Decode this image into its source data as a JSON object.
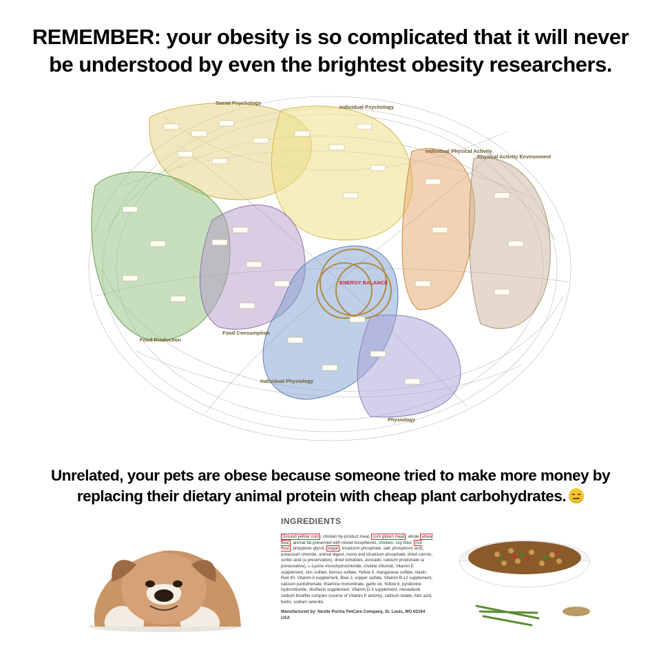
{
  "headline_top": {
    "line1": "REMEMBER:  your obesity is so complicated that it will never",
    "line2": "be understood by even the brightest obesity researchers."
  },
  "diagram": {
    "regions": [
      {
        "label": "Social Psychology",
        "color": "#e8d68a"
      },
      {
        "label": "Individual Psychology",
        "color": "#efe08a"
      },
      {
        "label": "Individual Physical Activity",
        "color": "#e6a66a"
      },
      {
        "label": "Physical Activity Environment",
        "color": "#c9b49a"
      },
      {
        "label": "Food Production",
        "color": "#8fc07a"
      },
      {
        "label": "Food Consumption",
        "color": "#b49ac8"
      },
      {
        "label": "Individual Physiology",
        "color": "#7e9fd0"
      },
      {
        "label": "Physiology",
        "color": "#a8a2d6"
      }
    ],
    "center_label": "ENERGY BALANCE"
  },
  "headline_mid": {
    "line1": "Unrelated, your pets are obese because someone tried to make more money by",
    "line2": "replacing their dietary animal protein with cheap plant carbohydrates."
  },
  "emoji_icon": "expressionless-face-icon",
  "ingredients": {
    "title": "INGREDIENTS",
    "highlighted": [
      "Ground yellow corn",
      "corn gluten meal",
      "wheat flour",
      "rice flour",
      "sugar"
    ],
    "text_1": ", chicken by-product meal, ",
    "text_2": ", whole ",
    "text_3": ", animal fat preserved with mixed-tocopherols, chicken, soy flour, ",
    "text_4": ", propylene glycol, ",
    "text_5": ", tricalcium phosphate, salt, phosphoric acid, potassium chloride, animal digest, mono and dicalcium phosphate, dried carrots, sorbic acid (a preservative), dried tomatoes, avocado, calcium propionate (a preservative), L-Lysine monohydrochloride, choline chloride, Vitamin E supplement, zinc sulfate, ferrous sulfate, Yellow 5, manganese sulfate, niacin, Red 40, Vitamin A supplement, Blue 2, copper sulfate, Vitamin B-12 supplement, calcium pantothenate, thiamine mononitrate, garlic oil, Yellow 6, pyridoxine hydrochloride, riboflavin supplement, Vitamin D-3 supplement, menadione sodium bisulfite complex (source of Vitamin K activity), calcium iodate, folic acid, biotin, sodium selenite.",
    "manufacturer": "Manufactured by: Nestlé Purina PetCare Company, St. Louis, MO 63164 USA"
  }
}
